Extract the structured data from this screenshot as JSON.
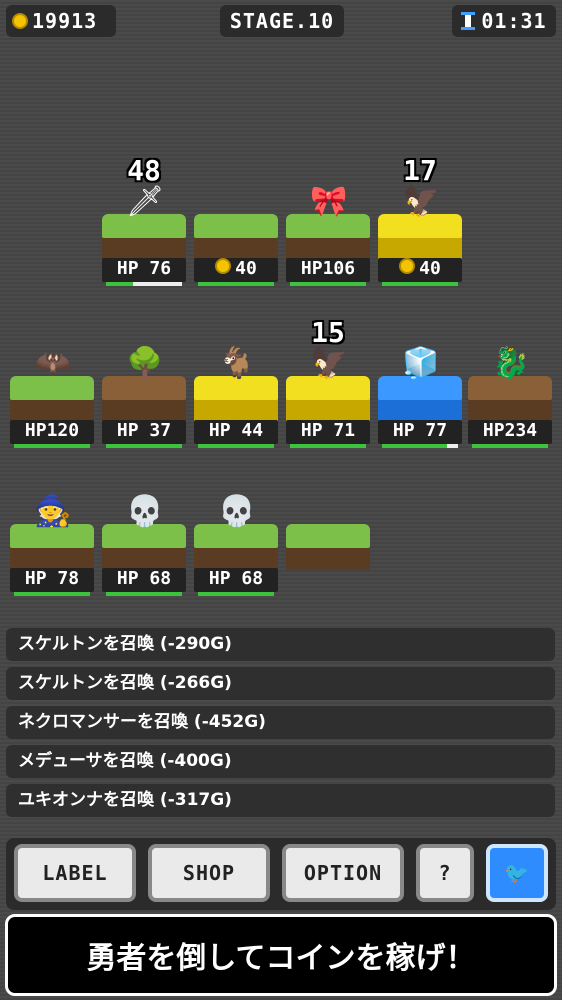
{
  "header": {
    "coins": "19913",
    "stage": "STAGE.10",
    "timer": "01:31"
  },
  "rows": [
    [
      {
        "label": "HP 76",
        "terrain": "grass",
        "monster": "🗡",
        "damage": "48",
        "hp_fraction": 0.35
      },
      {
        "label": "40",
        "terrain": "grass",
        "coin": true,
        "hp_fraction": 1.0
      },
      {
        "label": "HP106",
        "terrain": "grass",
        "monster": "🎀",
        "hp_fraction": 1.0
      },
      {
        "label": "40",
        "terrain": "gold",
        "coin": true,
        "monster": "🦅",
        "damage": "17",
        "hp_fraction": 1.0
      }
    ],
    [
      {
        "label": "HP120",
        "terrain": "grass",
        "monster": "🦇",
        "hp_fraction": 1.0
      },
      {
        "label": "HP 37",
        "terrain": "dirt",
        "monster": "🌳",
        "hp_fraction": 1.0
      },
      {
        "label": "HP 44",
        "terrain": "gold",
        "monster": "🐐",
        "hp_fraction": 1.0
      },
      {
        "label": "HP 71",
        "terrain": "gold",
        "monster": "🦅",
        "damage": "15",
        "hp_fraction": 1.0
      },
      {
        "label": "HP 77",
        "terrain": "water",
        "monster": "🧊",
        "hp_fraction": 0.85
      },
      {
        "label": "HP234",
        "terrain": "dirt",
        "monster": "🐉",
        "hp_fraction": 1.0
      }
    ],
    [
      {
        "label": "HP 78",
        "terrain": "grass",
        "monster": "🧙",
        "hp_fraction": 1.0
      },
      {
        "label": "HP 68",
        "terrain": "grass",
        "monster": "💀",
        "hp_fraction": 1.0
      },
      {
        "label": "HP 68",
        "terrain": "grass",
        "monster": "💀",
        "hp_fraction": 1.0
      },
      {
        "label": "",
        "terrain": "grass",
        "empty": true
      }
    ]
  ],
  "log": [
    "スケルトンを召喚 (-290G)",
    "スケルトンを召喚 (-266G)",
    "ネクロマンサーを召喚 (-452G)",
    "メデューサを召喚 (-400G)",
    "ユキオンナを召喚 (-317G)"
  ],
  "buttons": {
    "label": "LABEL",
    "shop": "SHOP",
    "option": "OPTION",
    "help": "?",
    "twitter": "🐦"
  },
  "banner": "勇者を倒してコインを稼げ！",
  "colors": {
    "coin": "#f5c400",
    "hp_bar": "#3cc23c",
    "twitter": "#2f8cff"
  }
}
